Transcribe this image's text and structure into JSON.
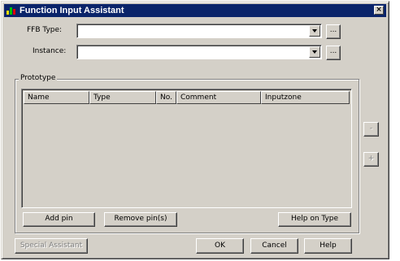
{
  "window": {
    "title": "Function Input Assistant",
    "close_glyph": "×"
  },
  "fields": {
    "ffb_type_label": "FFB Type:",
    "ffb_type_value": "",
    "instance_label": "Instance:",
    "instance_value": "",
    "browse_label": "..."
  },
  "prototype": {
    "group_label": "Prototype",
    "columns": [
      "Name",
      "Type",
      "No.",
      "Comment",
      "Inputzone"
    ],
    "rows": []
  },
  "side_buttons": {
    "minus": "-",
    "plus": "+"
  },
  "buttons": {
    "add_pin": "Add pin",
    "remove_pins": "Remove pin(s)",
    "help_on_type": "Help on Type",
    "special_assistant": "Special Assistant",
    "ok": "OK",
    "cancel": "Cancel",
    "help": "Help"
  }
}
